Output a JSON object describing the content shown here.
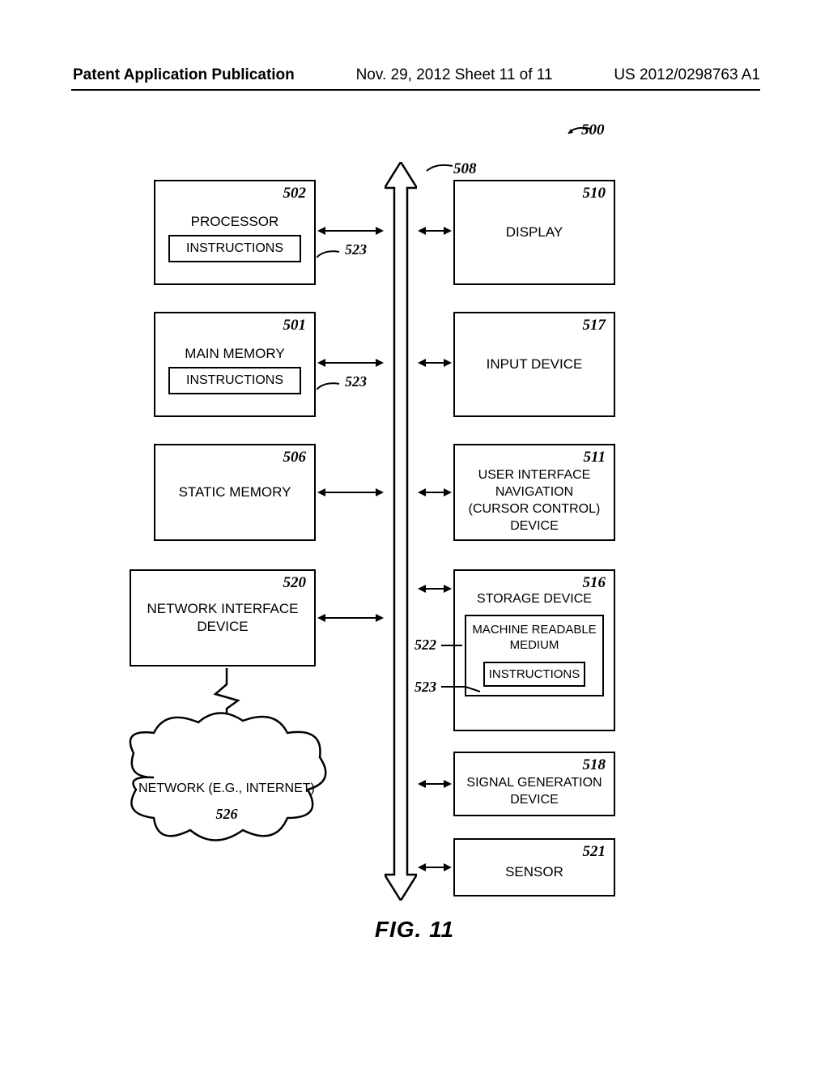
{
  "header": {
    "left": "Patent Application Publication",
    "center": "Nov. 29, 2012  Sheet 11 of 11",
    "right": "US 2012/0298763 A1"
  },
  "figure_ref": "500",
  "bus_ref": "508",
  "blocks": {
    "processor": {
      "ref": "502",
      "title": "PROCESSOR",
      "sub": "INSTRUCTIONS",
      "sub_ref": "523"
    },
    "main_memory": {
      "ref": "501",
      "title": "MAIN MEMORY",
      "sub": "INSTRUCTIONS",
      "sub_ref": "523"
    },
    "static_memory": {
      "ref": "506",
      "title": "STATIC MEMORY"
    },
    "nid": {
      "ref": "520",
      "title": "NETWORK INTERFACE DEVICE"
    },
    "display": {
      "ref": "510",
      "title": "DISPLAY"
    },
    "input": {
      "ref": "517",
      "title": "INPUT DEVICE"
    },
    "cursor": {
      "ref": "511",
      "title": "USER INTERFACE NAVIGATION (CURSOR CONTROL) DEVICE"
    },
    "storage": {
      "ref": "516",
      "title": "STORAGE DEVICE",
      "mrm": "MACHINE READABLE MEDIUM",
      "mrm_ref": "522",
      "instr": "INSTRUCTIONS",
      "instr_ref": "523"
    },
    "sig": {
      "ref": "518",
      "title": "SIGNAL GENERATION DEVICE"
    },
    "sensor": {
      "ref": "521",
      "title": "SENSOR"
    }
  },
  "network": {
    "label": "NETWORK (E.G., INTERNET)",
    "ref": "526"
  },
  "caption": "FIG. 11"
}
